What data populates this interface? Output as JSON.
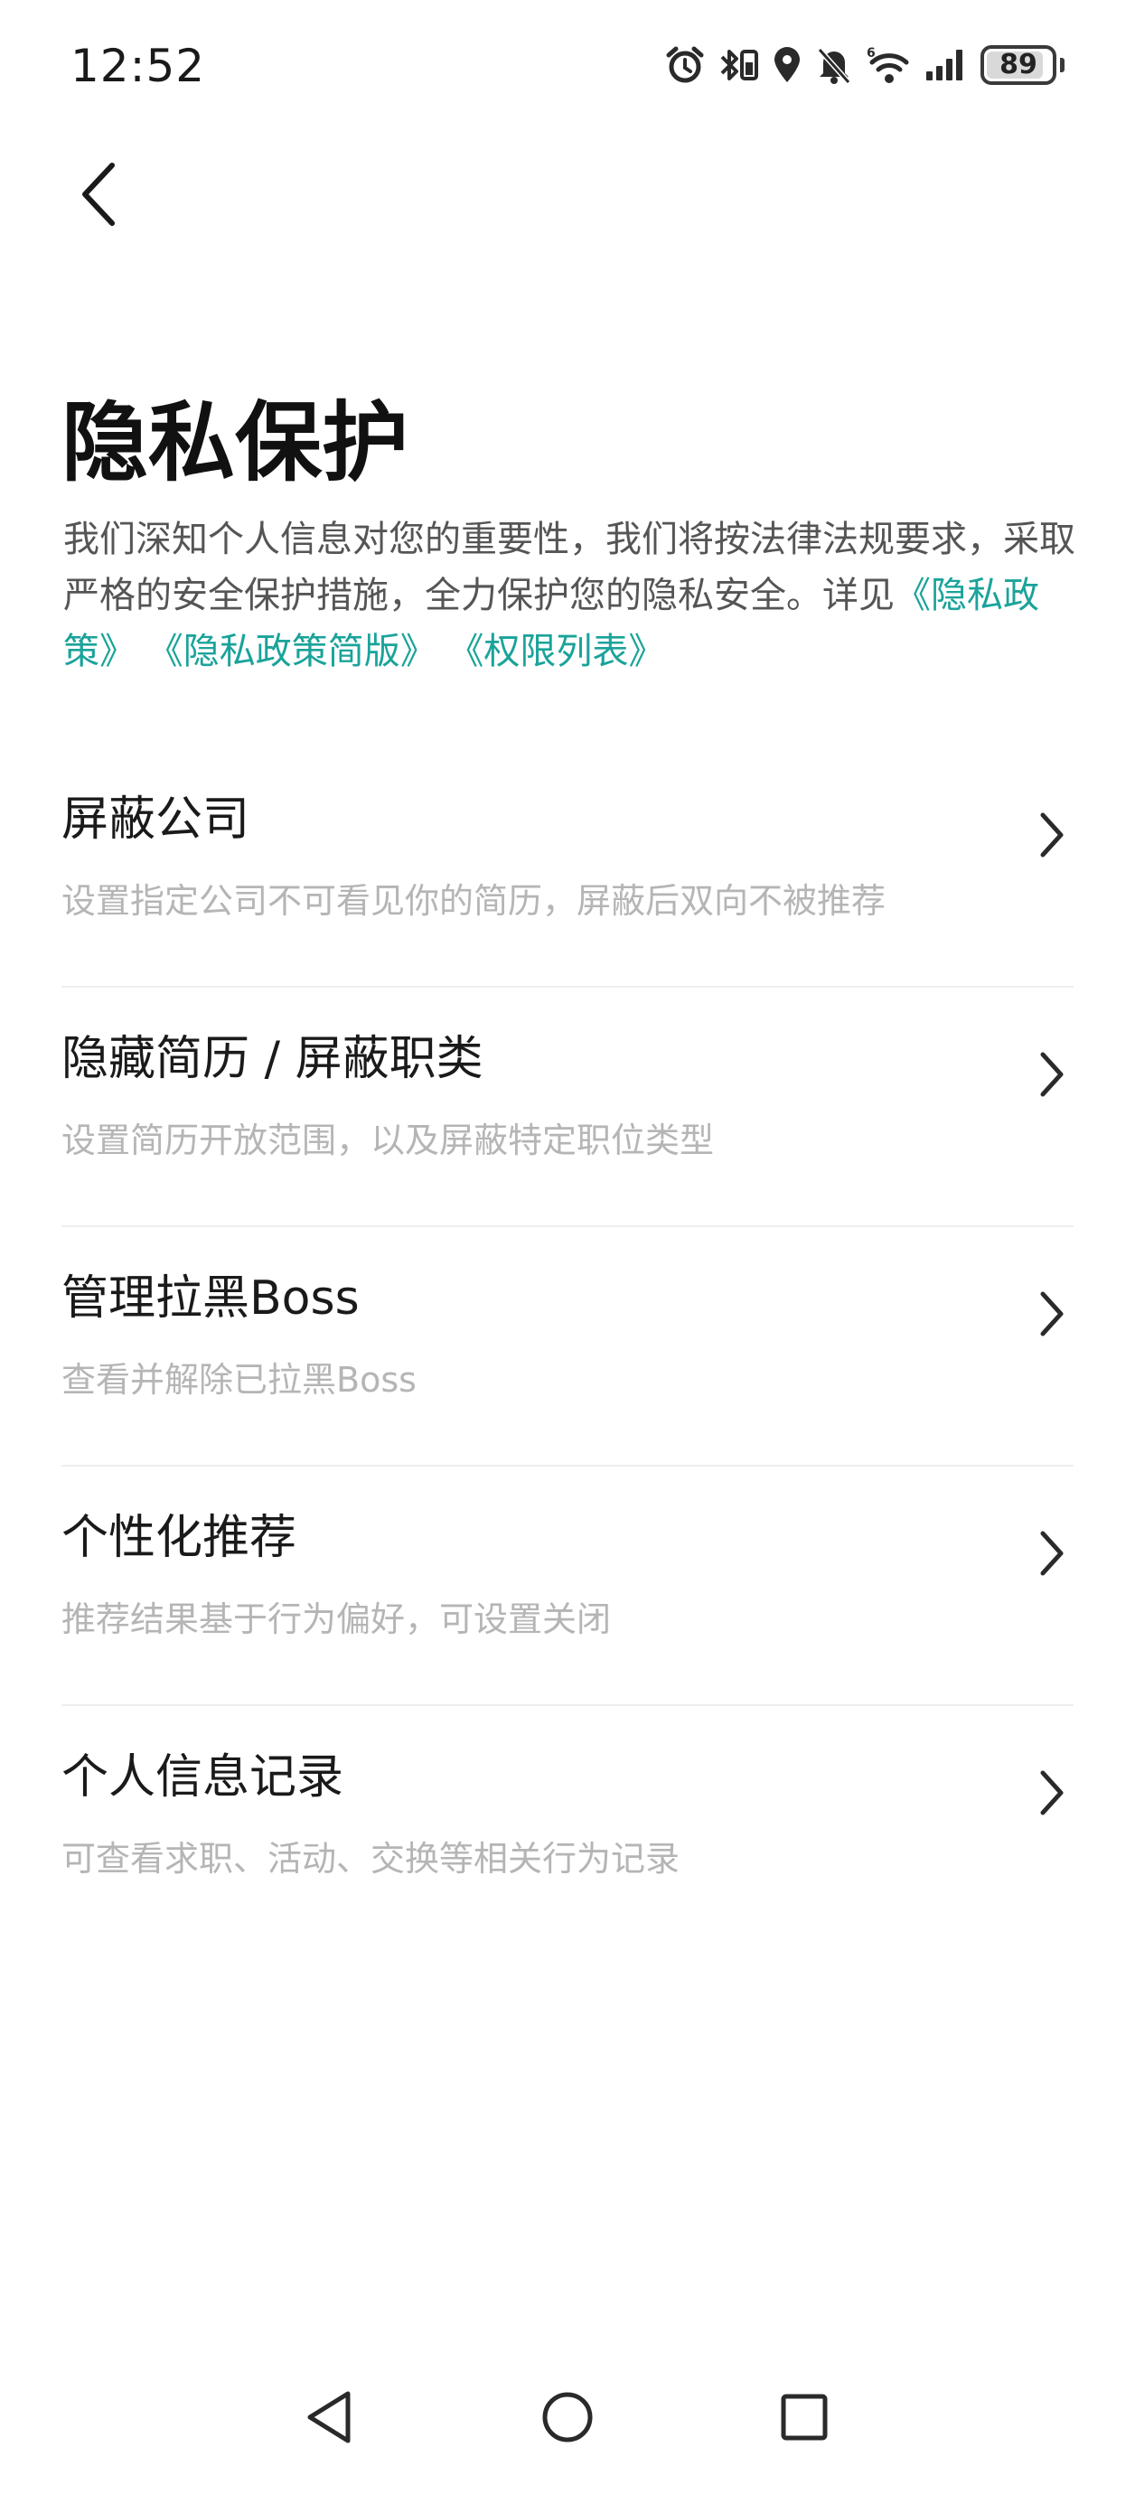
{
  "status_bar": {
    "time": "12:52",
    "battery_level": "89",
    "battery_fraction": 0.89,
    "icons": [
      "alarm-icon",
      "bluetooth-battery-icon",
      "location-icon",
      "mute-icon",
      "wifi-6-icon",
      "signal-icon",
      "battery-icon"
    ]
  },
  "header": {
    "back_icon": "chevron-left-icon",
    "title": "隐私保护",
    "intro_text": "我们深知个人信息对您的重要性，我们将按法律法规要求，采取严格的安全保护措施，全力保护您的隐私安全。详见",
    "links": {
      "privacy_policy": "《隐私政策》",
      "privacy_policy_brief": "《隐私政策简版》",
      "permission_list": "《权限列表》"
    },
    "link_color": "#1aa39a"
  },
  "settings": [
    {
      "title": "屏蔽公司",
      "description": "设置指定公司不可看见你的简历，屏蔽后双向不被推荐"
    },
    {
      "title": "隐藏简历 / 屏蔽职类",
      "description": "设置简历开放范围，以及屏蔽特定职位类型"
    },
    {
      "title": "管理拉黑Boss",
      "description": "查看并解除已拉黑Boss"
    },
    {
      "title": "个性化推荐",
      "description": "推荐结果基于行为偏好，可设置关闭"
    },
    {
      "title": "个人信息记录",
      "description": "可查看求职、活动、交换等相关行为记录"
    }
  ],
  "nav_bar": {
    "icons": [
      "nav-back-icon",
      "nav-home-icon",
      "nav-recent-icon"
    ]
  }
}
